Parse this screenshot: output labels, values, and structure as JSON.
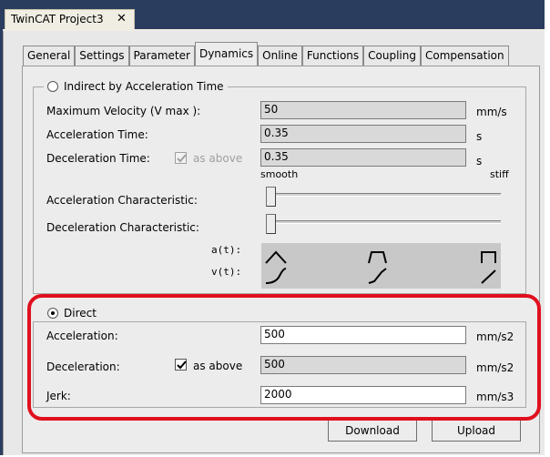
{
  "document_tab": {
    "title": "TwinCAT Project3",
    "close_glyph": "✕"
  },
  "tabs": [
    {
      "label": "General"
    },
    {
      "label": "Settings"
    },
    {
      "label": "Parameter"
    },
    {
      "label": "Dynamics",
      "active": true
    },
    {
      "label": "Online"
    },
    {
      "label": "Functions"
    },
    {
      "label": "Coupling"
    },
    {
      "label": "Compensation"
    }
  ],
  "indirect_group": {
    "label": "Indirect by Acceleration Time",
    "selected": false,
    "max_velocity": {
      "label": "Maximum Velocity (V max ):",
      "value": "50",
      "unit": "mm/s"
    },
    "acceleration_time": {
      "label": "Acceleration Time:",
      "value": "0.35",
      "unit": "s"
    },
    "deceleration_time": {
      "label": "Deceleration Time:",
      "value": "0.35",
      "unit": "s",
      "as_above_label": "as above",
      "as_above_checked": true,
      "as_above_enabled": false
    },
    "slider_scale": {
      "left": "smooth",
      "right": "stiff"
    },
    "accel_characteristic": {
      "label": "Acceleration Characteristic:",
      "position": 0
    },
    "decel_characteristic": {
      "label": "Deceleration Characteristic:",
      "position": 0
    },
    "graph_labels": {
      "a": "a(t):",
      "v": "v(t):"
    }
  },
  "direct_group": {
    "label": "Direct",
    "selected": true,
    "acceleration": {
      "label": "Acceleration:",
      "value": "500",
      "unit": "mm/s2"
    },
    "deceleration": {
      "label": "Deceleration:",
      "value": "500",
      "unit": "mm/s2",
      "as_above_label": "as above",
      "as_above_checked": true
    },
    "jerk": {
      "label": "Jerk:",
      "value": "2000",
      "unit": "mm/s3"
    }
  },
  "buttons": {
    "download": "Download",
    "upload": "Upload"
  },
  "colors": {
    "highlight": "#e0101e",
    "frame": "#2b3d5f"
  }
}
